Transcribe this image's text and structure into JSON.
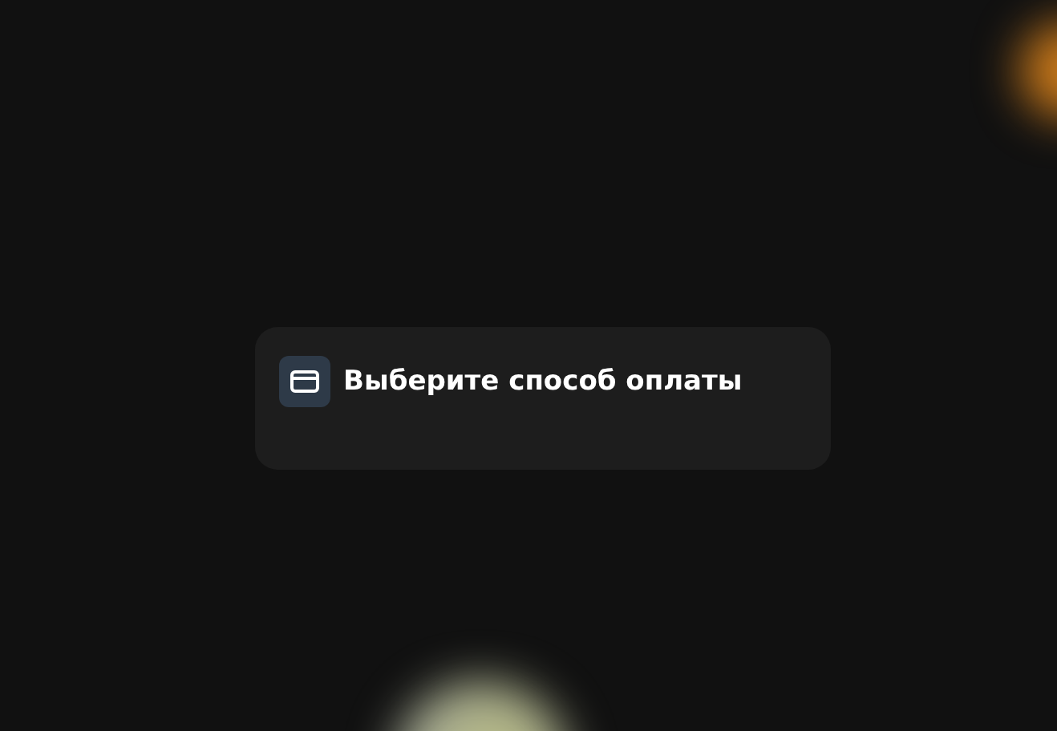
{
  "dialog": {
    "title": "Выберите способ оплаты"
  }
}
